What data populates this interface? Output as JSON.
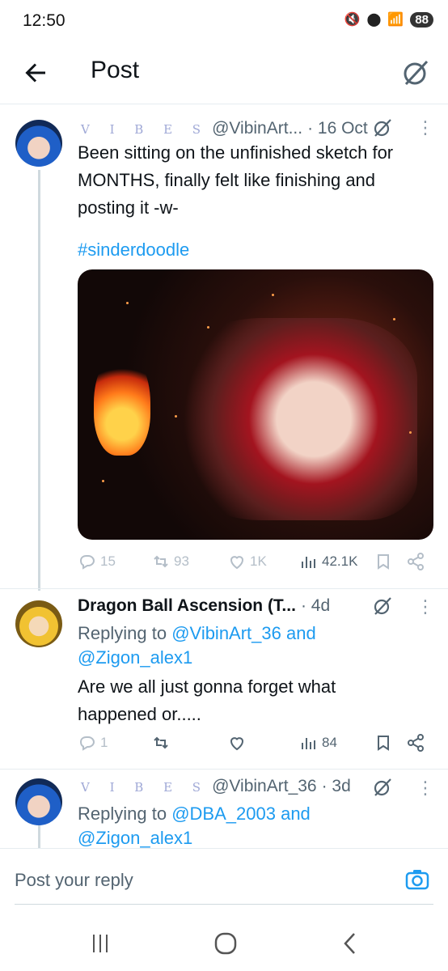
{
  "status": {
    "time": "12:50",
    "battery": "88",
    "network": "6"
  },
  "header": {
    "title": "Post"
  },
  "post": {
    "author_label": "V I B E S",
    "handle": "@VibinArt...",
    "time": "· 16 Oct",
    "text_lines": [
      "Been sitting on the unfinished sketch for",
      "MONTHS, finally felt like finishing and",
      "posting it -w-"
    ],
    "hashtag": "#sinderdoodle",
    "stats": {
      "replies": "15",
      "reposts": "93",
      "likes": "1K",
      "views": "42.1K"
    }
  },
  "reply1": {
    "author": "Dragon Ball Ascension (T...",
    "time": "· 4d",
    "replying_prefix": "Replying to",
    "mention1": "@VibinArt_36",
    "and_word": "and",
    "mention2": "@Zigon_alex1",
    "text_lines": [
      "Are we all just gonna forget what",
      "happened or....."
    ],
    "stats": {
      "replies": "1",
      "views": "84"
    }
  },
  "reply2": {
    "author_label": "V I B E S",
    "handle": "@VibinArt_36",
    "time": "· 3d",
    "replying_prefix": "Replying to",
    "mention1": "@DBA_2003",
    "and_word": "and",
    "mention2": "@Zigon_alex1"
  },
  "composer": {
    "placeholder": "Post your reply"
  },
  "icons": {
    "back": "arrow-left-icon",
    "grok": "grok-icon",
    "more": "more-icon",
    "reply": "reply-icon",
    "repost": "repost-icon",
    "like": "like-icon",
    "views": "views-icon",
    "bookmark": "bookmark-icon",
    "share": "share-icon",
    "camera": "camera-icon"
  },
  "colors": {
    "accent": "#1d9bf0",
    "muted": "#536471",
    "faded": "#b4bec8"
  }
}
